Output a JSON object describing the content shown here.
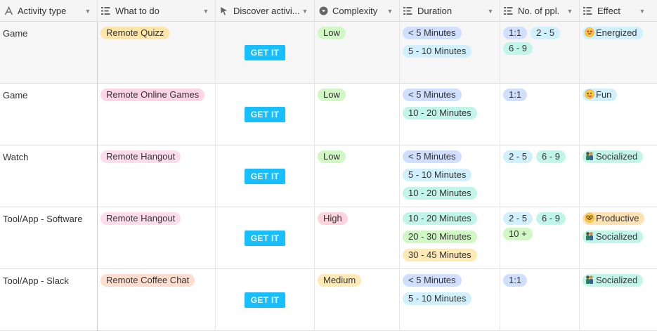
{
  "columns": [
    {
      "key": "activity_type",
      "label": "Activity type",
      "icon": "text-icon"
    },
    {
      "key": "what_to_do",
      "label": "What to do",
      "icon": "multiselect-icon"
    },
    {
      "key": "discover",
      "label": "Discover activi...",
      "icon": "cursor-icon"
    },
    {
      "key": "complexity",
      "label": "Complexity",
      "icon": "single-select-icon"
    },
    {
      "key": "duration",
      "label": "Duration",
      "icon": "multiselect-icon"
    },
    {
      "key": "num_ppl",
      "label": "No. of ppl.",
      "icon": "multiselect-icon"
    },
    {
      "key": "effect",
      "label": "Effect",
      "icon": "multiselect-icon"
    }
  ],
  "button_label": "GET IT",
  "rows": [
    {
      "activity_type": "Game",
      "what_to_do": {
        "label": "Remote Quizz",
        "color": "#ffe5a8"
      },
      "complexity": {
        "label": "Low",
        "color": "#d1f7c4"
      },
      "duration": [
        {
          "label": "< 5 Minutes",
          "color": "#d0dfff"
        },
        {
          "label": "5 - 10 Minutes",
          "color": "#d0f0fd"
        }
      ],
      "num_ppl": [
        {
          "label": "1:1",
          "color": "#d0dfff"
        },
        {
          "label": "2 - 5",
          "color": "#d0f0fd"
        },
        {
          "label": "6 - 9",
          "color": "#c2f5e9"
        }
      ],
      "effect": [
        {
          "label": "Energized",
          "icon": "star-eyes-emoji-icon",
          "color": "#d0f0fd"
        }
      ]
    },
    {
      "activity_type": "Game",
      "what_to_do": {
        "label": "Remote Online Games",
        "color": "#ffd4e4"
      },
      "complexity": {
        "label": "Low",
        "color": "#d1f7c4"
      },
      "duration": [
        {
          "label": "< 5 Minutes",
          "color": "#d0dfff"
        },
        {
          "label": "10 - 20 Minutes",
          "color": "#c2f5e9"
        }
      ],
      "num_ppl": [
        {
          "label": "1:1",
          "color": "#d0dfff"
        }
      ],
      "effect": [
        {
          "label": "Fun",
          "icon": "silly-face-emoji-icon",
          "color": "#d0f0fd"
        }
      ]
    },
    {
      "activity_type": "Watch",
      "what_to_do": {
        "label": "Remote Hangout",
        "color": "#ffdcec"
      },
      "complexity": {
        "label": "Low",
        "color": "#d1f7c4"
      },
      "duration": [
        {
          "label": "< 5 Minutes",
          "color": "#d0dfff"
        },
        {
          "label": "5 - 10 Minutes",
          "color": "#d0f0fd"
        },
        {
          "label": "10 - 20 Minutes",
          "color": "#c2f5e9"
        }
      ],
      "num_ppl": [
        {
          "label": "2 - 5",
          "color": "#d0f0fd"
        },
        {
          "label": "6 - 9",
          "color": "#c2f5e9"
        }
      ],
      "effect": [
        {
          "label": "Socialized",
          "icon": "people-emoji-icon",
          "color": "#c2f5e9"
        }
      ]
    },
    {
      "activity_type": "Tool/App - Software",
      "what_to_do": {
        "label": "Remote Hangout",
        "color": "#ffdcec"
      },
      "complexity": {
        "label": "High",
        "color": "#ffd4de"
      },
      "duration": [
        {
          "label": "10 - 20 Minutes",
          "color": "#c2f5e9"
        },
        {
          "label": "20 - 30 Minutes",
          "color": "#d1f7c4"
        },
        {
          "label": "30 - 45 Minutes",
          "color": "#ffeab6"
        }
      ],
      "num_ppl": [
        {
          "label": "2 - 5",
          "color": "#d0f0fd"
        },
        {
          "label": "6 - 9",
          "color": "#c2f5e9"
        },
        {
          "label": "10 +",
          "color": "#d1f7c4"
        }
      ],
      "effect": [
        {
          "label": "Productive",
          "icon": "nerd-face-emoji-icon",
          "color": "#fee2b4"
        },
        {
          "label": "Socialized",
          "icon": "people-emoji-icon",
          "color": "#c2f5e9"
        }
      ]
    },
    {
      "activity_type": "Tool/App - Slack",
      "what_to_do": {
        "label": "Remote Coffee Chat",
        "color": "#ffdccd"
      },
      "complexity": {
        "label": "Medium",
        "color": "#ffeab6"
      },
      "duration": [
        {
          "label": "< 5 Minutes",
          "color": "#d0dfff"
        },
        {
          "label": "5 - 10 Minutes",
          "color": "#d0f0fd"
        }
      ],
      "num_ppl": [
        {
          "label": "1:1",
          "color": "#d0dfff"
        }
      ],
      "effect": [
        {
          "label": "Socialized",
          "icon": "people-emoji-icon",
          "color": "#c2f5e9"
        }
      ]
    }
  ]
}
